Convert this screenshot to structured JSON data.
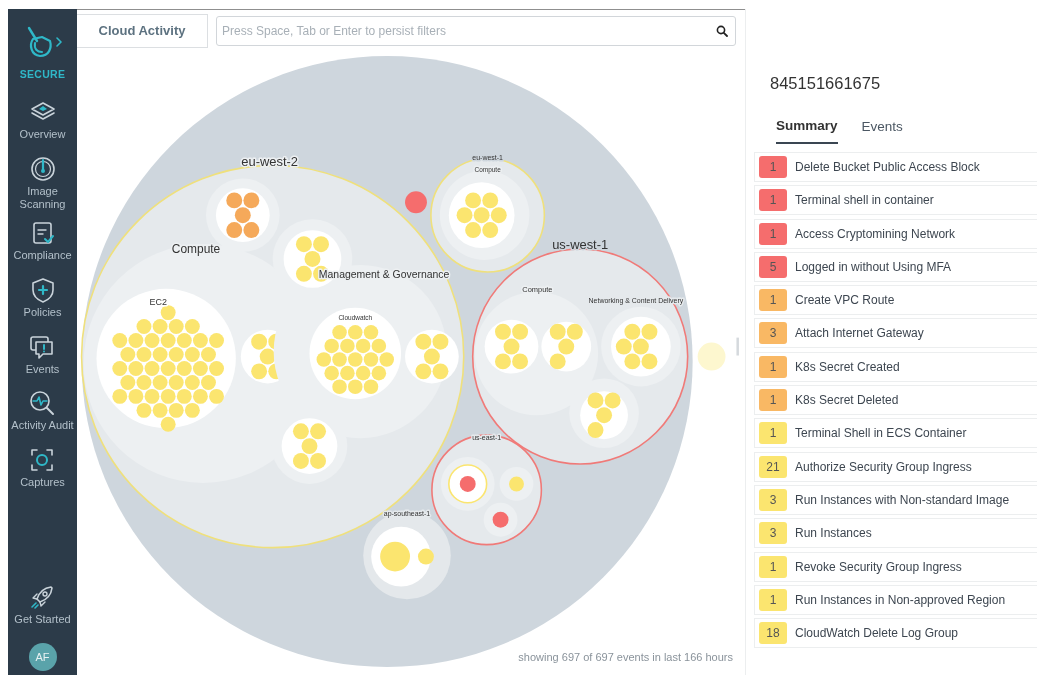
{
  "sidebar": {
    "brand": "SECURE",
    "items": [
      {
        "label": "Overview"
      },
      {
        "label": "Image Scanning"
      },
      {
        "label": "Compliance"
      },
      {
        "label": "Policies"
      },
      {
        "label": "Events"
      },
      {
        "label": "Activity Audit"
      },
      {
        "label": "Captures"
      },
      {
        "label": "Get Started"
      }
    ],
    "avatar": "AF"
  },
  "toolbar": {
    "tab": "Cloud Activity",
    "search": {
      "placeholder": "Press Space, Tab or Enter to persist filters"
    }
  },
  "chart": {
    "regions": [
      {
        "name": "eu-west-2",
        "color": "#efe07c"
      },
      {
        "name": "eu-west-1",
        "color": "#efe07c"
      },
      {
        "name": "us-west-1",
        "color": "#f07a78"
      },
      {
        "name": "us-east-1",
        "color": "#f07a78"
      },
      {
        "name": "ap-southeast-1",
        "color": "#e4e8eb"
      }
    ],
    "labels": [
      "Compute",
      "Management & Governance",
      "EC2",
      "Cloudwatch",
      "Compute",
      "Compute",
      "Networking & Content Delivery"
    ],
    "footer": "showing 697 of 697 events in last 166 hours"
  },
  "details": {
    "title": "845151661675",
    "tabs": [
      {
        "label": "Summary",
        "selected": true
      },
      {
        "label": "Events",
        "selected": false
      }
    ],
    "events": [
      {
        "count": "1",
        "label": "Delete Bucket Public Access Block",
        "color": "#f56d6d"
      },
      {
        "count": "1",
        "label": "Terminal shell in container",
        "color": "#f56d6d"
      },
      {
        "count": "1",
        "label": "Access Cryptomining Network",
        "color": "#f56d6d"
      },
      {
        "count": "5",
        "label": "Logged in without Using MFA",
        "color": "#f56d6d"
      },
      {
        "count": "1",
        "label": "Create VPC Route",
        "color": "#f9b864"
      },
      {
        "count": "3",
        "label": "Attach Internet Gateway",
        "color": "#f9b864"
      },
      {
        "count": "1",
        "label": "K8s Secret Created",
        "color": "#f9b864"
      },
      {
        "count": "1",
        "label": "K8s Secret Deleted",
        "color": "#f9b864"
      },
      {
        "count": "1",
        "label": "Terminal Shell in ECS Container",
        "color": "#fbe56f"
      },
      {
        "count": "21",
        "label": "Authorize Security Group Ingress",
        "color": "#fbe56f"
      },
      {
        "count": "3",
        "label": "Run Instances with Non-standard Image",
        "color": "#fbe56f"
      },
      {
        "count": "3",
        "label": "Run Instances",
        "color": "#fbe56f"
      },
      {
        "count": "1",
        "label": "Revoke Security Group Ingress",
        "color": "#fbe56f"
      },
      {
        "count": "1",
        "label": "Run Instances in Non-approved Region",
        "color": "#fbe56f"
      },
      {
        "count": "18",
        "label": "CloudWatch Delete Log Group",
        "color": "#fbe56f"
      }
    ]
  }
}
